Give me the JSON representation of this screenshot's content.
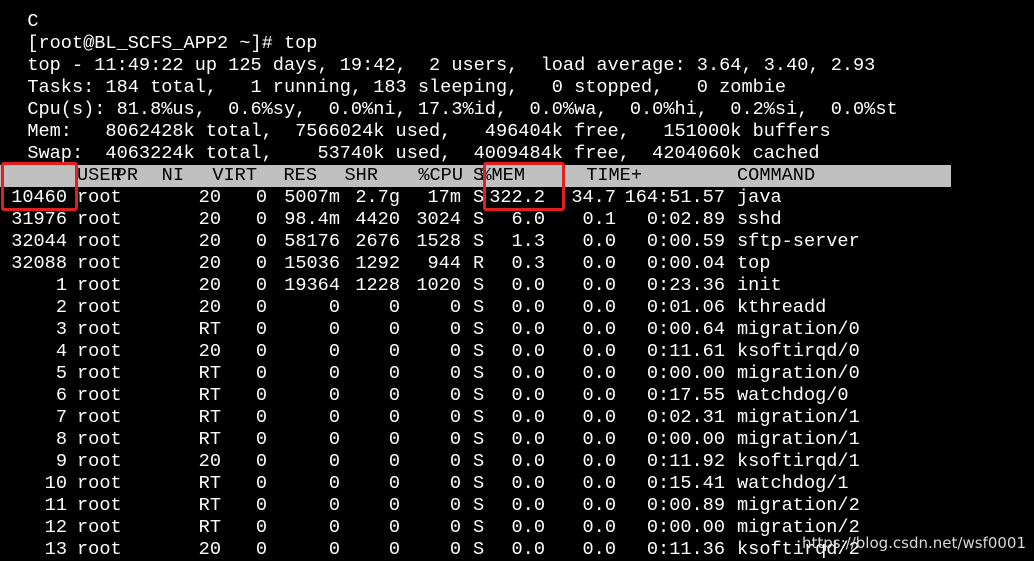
{
  "terminal": {
    "clipped_top_line": "C",
    "prompt": "[root@BL_SCFS_APP2 ~]# top",
    "summary": [
      "top - 11:49:22 up 125 days, 19:42,  2 users,  load average: 3.64, 3.40, 2.93",
      "Tasks: 184 total,   1 running, 183 sleeping,   0 stopped,   0 zombie",
      "Cpu(s): 81.8%us,  0.6%sy,  0.0%ni, 17.3%id,  0.0%wa,  0.0%hi,  0.2%si,  0.0%st",
      "Mem:   8062428k total,  7566024k used,   496404k free,   151000k buffers",
      "Swap:  4063224k total,    53740k used,  4009484k free,  4204060k cached"
    ]
  },
  "table": {
    "columns": [
      "PID",
      "USER",
      "PR",
      "NI",
      "VIRT",
      "RES",
      "SHR",
      "S",
      "%CPU",
      "%MEM",
      "TIME+",
      "COMMAND"
    ],
    "rows": [
      [
        "10460",
        "root",
        "20",
        "0",
        "5007m",
        "2.7g",
        "17m",
        "S",
        "322.2",
        "34.7",
        "164:51.57",
        "java"
      ],
      [
        "31976",
        "root",
        "20",
        "0",
        "98.4m",
        "4420",
        "3024",
        "S",
        "6.0",
        "0.1",
        "0:02.89",
        "sshd"
      ],
      [
        "32044",
        "root",
        "20",
        "0",
        "58176",
        "2676",
        "1528",
        "S",
        "1.3",
        "0.0",
        "0:00.59",
        "sftp-server"
      ],
      [
        "32088",
        "root",
        "20",
        "0",
        "15036",
        "1292",
        "944",
        "R",
        "0.3",
        "0.0",
        "0:00.04",
        "top"
      ],
      [
        "1",
        "root",
        "20",
        "0",
        "19364",
        "1228",
        "1020",
        "S",
        "0.0",
        "0.0",
        "0:23.36",
        "init"
      ],
      [
        "2",
        "root",
        "20",
        "0",
        "0",
        "0",
        "0",
        "S",
        "0.0",
        "0.0",
        "0:01.06",
        "kthreadd"
      ],
      [
        "3",
        "root",
        "RT",
        "0",
        "0",
        "0",
        "0",
        "S",
        "0.0",
        "0.0",
        "0:00.64",
        "migration/0"
      ],
      [
        "4",
        "root",
        "20",
        "0",
        "0",
        "0",
        "0",
        "S",
        "0.0",
        "0.0",
        "0:11.61",
        "ksoftirqd/0"
      ],
      [
        "5",
        "root",
        "RT",
        "0",
        "0",
        "0",
        "0",
        "S",
        "0.0",
        "0.0",
        "0:00.00",
        "migration/0"
      ],
      [
        "6",
        "root",
        "RT",
        "0",
        "0",
        "0",
        "0",
        "S",
        "0.0",
        "0.0",
        "0:17.55",
        "watchdog/0"
      ],
      [
        "7",
        "root",
        "RT",
        "0",
        "0",
        "0",
        "0",
        "S",
        "0.0",
        "0.0",
        "0:02.31",
        "migration/1"
      ],
      [
        "8",
        "root",
        "RT",
        "0",
        "0",
        "0",
        "0",
        "S",
        "0.0",
        "0.0",
        "0:00.00",
        "migration/1"
      ],
      [
        "9",
        "root",
        "20",
        "0",
        "0",
        "0",
        "0",
        "S",
        "0.0",
        "0.0",
        "0:11.92",
        "ksoftirqd/1"
      ],
      [
        "10",
        "root",
        "RT",
        "0",
        "0",
        "0",
        "0",
        "S",
        "0.0",
        "0.0",
        "0:15.41",
        "watchdog/1"
      ],
      [
        "11",
        "root",
        "RT",
        "0",
        "0",
        "0",
        "0",
        "S",
        "0.0",
        "0.0",
        "0:00.89",
        "migration/2"
      ],
      [
        "12",
        "root",
        "RT",
        "0",
        "0",
        "0",
        "0",
        "S",
        "0.0",
        "0.0",
        "0:00.00",
        "migration/2"
      ],
      [
        "13",
        "root",
        "20",
        "0",
        "0",
        "0",
        "0",
        "S",
        "0.0",
        "0.0",
        "0:11.36",
        "ksoftirqd/2"
      ]
    ]
  },
  "watermark": "https://blog.csdn.net/wsf0001",
  "colors": {
    "background": "#000000",
    "text": "#ffffff",
    "header_bar": "#c0c0c0",
    "highlight": "#e02020"
  }
}
